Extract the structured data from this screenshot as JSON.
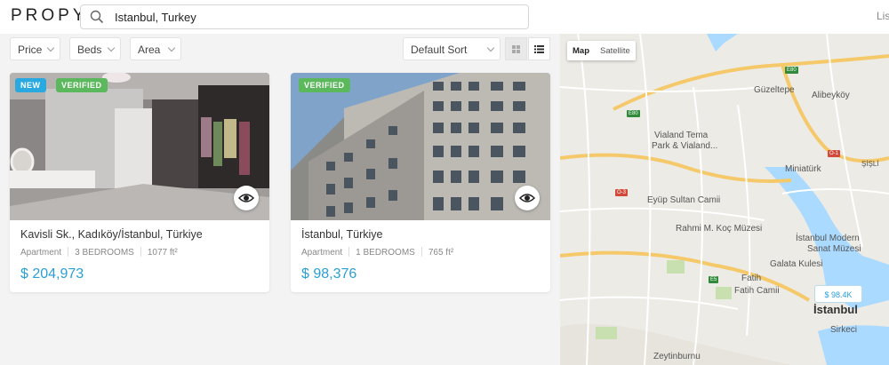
{
  "header": {
    "logo": "PROPY",
    "search_value": "Istanbul, Turkey",
    "right_link": "Lis"
  },
  "filters": {
    "price": "Price",
    "beds": "Beds",
    "area": "Area",
    "sort": "Default Sort"
  },
  "listings": [
    {
      "badges": [
        "NEW",
        "VERIFIED"
      ],
      "address": "Kavisli Sk., Kadıköy/İstanbul, Türkiye",
      "type": "Apartment",
      "bedrooms": "3 BEDROOMS",
      "area": "1077 ft²",
      "price": "$ 204,973"
    },
    {
      "badges": [
        "VERIFIED"
      ],
      "address": "İstanbul, Türkiye",
      "type": "Apartment",
      "bedrooms": "1 BEDROOMS",
      "area": "765 ft²",
      "price": "$ 98,376"
    }
  ],
  "map": {
    "tab_map": "Map",
    "tab_satellite": "Satellite",
    "marker": "$ 98.4K",
    "labels": {
      "guzeltepe": "Güzeltepe",
      "alibeykoy": "Alibeyköy",
      "vialand": "Vialand Tema",
      "vialand2": "Park & Vialand...",
      "miniaturk": "Miniatürk",
      "eyup": "Eyüp Sultan Camii",
      "rahmi": "Rahmi M. Koç Müzesi",
      "ist_modern": "İstanbul Modern",
      "sanat": "Sanat Müzesi",
      "galata": "Galata Kulesi",
      "fatih": "Fatih",
      "fatih_camii": "Fatih Camii",
      "istanbul": "İstanbul",
      "sirkeci": "Sirkeci",
      "zeytinburnu": "Zeytinburnu",
      "sisli": "ŞİŞLİ"
    },
    "shields": {
      "e80a": "E80",
      "e80b": "E80",
      "o1": "O-1",
      "o3": "O-3",
      "e5": "E5"
    }
  },
  "colors": {
    "accent": "#2a9fd6",
    "badge_new": "#2aa9e0",
    "badge_verified": "#5cb85c"
  }
}
